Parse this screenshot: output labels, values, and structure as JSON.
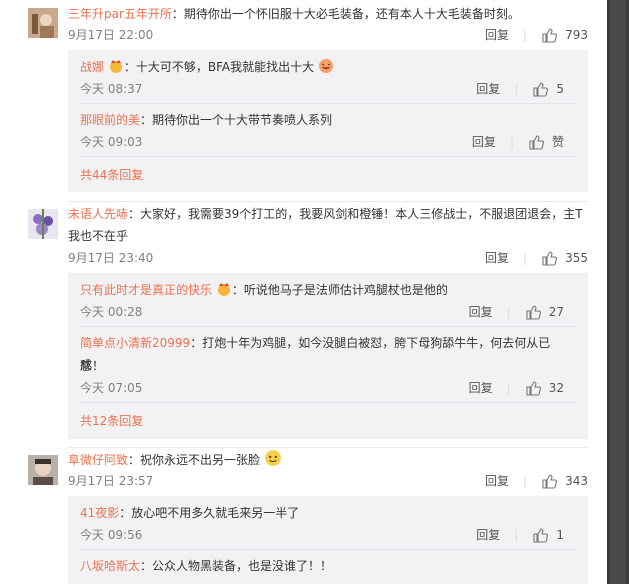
{
  "comments": [
    {
      "user": "三年升par五年开所",
      "text": "：期待你出一个怀旧服十大必毛装备，还有本人十大毛装备时刻。",
      "time": "9月17日 22:00",
      "reply_label": "回复",
      "likes": "793",
      "replies": [
        {
          "user": "战娜",
          "text": "：十大可不够，BFA我就能找出十大",
          "time": "今天 08:37",
          "reply_label": "回复",
          "likes": "5"
        },
        {
          "user": "那眼前的美",
          "text": "：期待你出一个十大带节奏喷人系列",
          "time": "今天 09:03",
          "reply_label": "回复",
          "likes": "赞"
        }
      ],
      "more": "共44条回复"
    },
    {
      "user": "未语人先哧",
      "text_line1": "：大家好，我需要39个打工的，我要风剑和橙锤！本人三修战士，不服退团退会，主T",
      "text_line2": "我也不在乎",
      "time": "9月17日 23:40",
      "reply_label": "回复",
      "likes": "355",
      "replies": [
        {
          "user": "只有此时才是真正的快乐",
          "text": "：听说他马子是法师估计鸡腿杖也是他的",
          "time": "今天 00:28",
          "reply_label": "回复",
          "likes": "27"
        },
        {
          "user": "简单点小清新20999",
          "text_line1": "：打炮十年为鸡腿，如今没腿白被怼，胯下母狗舔牛牛，何去何从已成",
          "text_line2": "愁！",
          "time": "今天 07:05",
          "reply_label": "回复",
          "likes": "32"
        }
      ],
      "more": "共12条回复"
    },
    {
      "user": "阜微仔阿致",
      "text": "：祝你永远不出另一张脸",
      "time": "9月17日 23:57",
      "reply_label": "回复",
      "likes": "343",
      "replies": [
        {
          "user": "41夜影",
          "text": "：放心吧不用多久就毛来另一半了",
          "time": "今天 09:56",
          "reply_label": "回复",
          "likes": "1"
        },
        {
          "user": "八坂哈斯太",
          "text": "：公众人物黑装备，也是没谁了！！"
        }
      ]
    }
  ],
  "colors": {
    "username": "#eb7350",
    "reply_bg": "#f2f2f5",
    "meta": "#808080"
  }
}
